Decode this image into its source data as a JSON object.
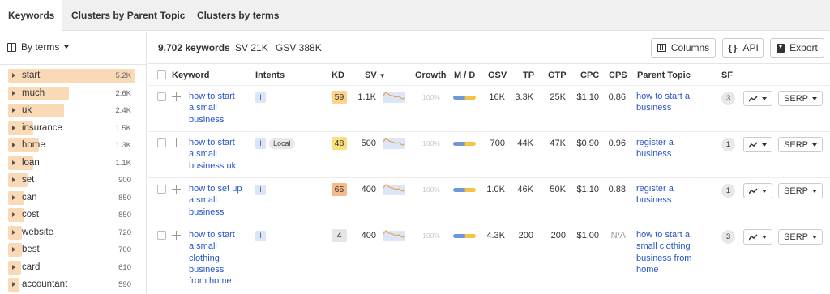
{
  "tabs": [
    "Keywords",
    "Clusters by Parent Topic",
    "Clusters by terms"
  ],
  "sidebar": {
    "mode_label": "By terms",
    "terms": [
      {
        "term": "start",
        "count": "5.2K",
        "share": 1.0
      },
      {
        "term": "much",
        "count": "2.6K",
        "share": 0.48
      },
      {
        "term": "uk",
        "count": "2.4K",
        "share": 0.44
      },
      {
        "term": "insurance",
        "count": "1.5K",
        "share": 0.2
      },
      {
        "term": "home",
        "count": "1.3K",
        "share": 0.24
      },
      {
        "term": "loan",
        "count": "1.1K",
        "share": 0.2
      },
      {
        "term": "set",
        "count": "900",
        "share": 0.15
      },
      {
        "term": "can",
        "count": "850",
        "share": 0.13
      },
      {
        "term": "cost",
        "count": "850",
        "share": 0.13
      },
      {
        "term": "website",
        "count": "720",
        "share": 0.11
      },
      {
        "term": "best",
        "count": "700",
        "share": 0.11
      },
      {
        "term": "card",
        "count": "610",
        "share": 0.1
      },
      {
        "term": "accountant",
        "count": "590",
        "share": 0.09
      }
    ]
  },
  "summary": {
    "keywords": "9,702 keywords",
    "sv": "SV 21K",
    "gsv": "GSV 388K"
  },
  "toolbar": {
    "columns_label": "Columns",
    "api_label": "API",
    "api_icon": "{}",
    "export_label": "Export"
  },
  "table": {
    "headers": {
      "keyword": "Keyword",
      "intents": "Intents",
      "kd": "KD",
      "sv": "SV",
      "growth": "Growth",
      "md": "M / D",
      "gsv": "GSV",
      "tp": "TP",
      "gtp": "GTP",
      "cpc": "CPC",
      "cps": "CPS",
      "parent_topic": "Parent Topic",
      "sf": "SF"
    },
    "rows": [
      {
        "keyword": [
          "how to start",
          "a small",
          "business"
        ],
        "intents": [
          "I"
        ],
        "kd": "59",
        "kd_color": "#fbd38a",
        "sv": "1.1K",
        "growth": "100%",
        "gsv": "16K",
        "tp": "3.3K",
        "gtp": "25K",
        "cpc": "$1.10",
        "cps": "0.86",
        "parent_topic": [
          "how to start a",
          "business"
        ],
        "sf": "3",
        "serp": "SERP"
      },
      {
        "keyword": [
          "how to start",
          "a small",
          "business uk"
        ],
        "intents": [
          "I",
          "Local"
        ],
        "kd": "48",
        "kd_color": "#f8e07a",
        "sv": "500",
        "growth": "100%",
        "gsv": "700",
        "tp": "44K",
        "gtp": "47K",
        "cpc": "$0.90",
        "cps": "0.96",
        "parent_topic": [
          "register a",
          "business"
        ],
        "sf": "1",
        "serp": "SERP"
      },
      {
        "keyword": [
          "how to set up",
          "a small",
          "business"
        ],
        "intents": [
          "I"
        ],
        "kd": "65",
        "kd_color": "#f6b98a",
        "sv": "400",
        "growth": "100%",
        "gsv": "1.0K",
        "tp": "46K",
        "gtp": "50K",
        "cpc": "$1.10",
        "cps": "0.88",
        "parent_topic": [
          "register a",
          "business"
        ],
        "sf": "1",
        "serp": "SERP"
      },
      {
        "keyword": [
          "how to start",
          "a small",
          "clothing",
          "business",
          "from home"
        ],
        "intents": [
          "I"
        ],
        "kd": "4",
        "kd_color": "#e6e6e6",
        "sv": "400",
        "growth": "100%",
        "gsv": "4.3K",
        "tp": "200",
        "gtp": "200",
        "cpc": "$1.00",
        "cps": "N/A",
        "parent_topic": [
          "how to start a",
          "small clothing",
          "business from",
          "home"
        ],
        "sf": "3",
        "serp": "SERP"
      }
    ]
  },
  "colors": {
    "term_bar": "#f9d9b6",
    "link": "#2755c5",
    "spark_line": "#e8a45a",
    "spark_fill": "#dce6f6"
  },
  "icons": [
    "book-icon",
    "sort-down-icon",
    "columns-icon",
    "api-icon",
    "export-icon",
    "trend-icon",
    "chevron-down-icon",
    "plus-icon"
  ]
}
